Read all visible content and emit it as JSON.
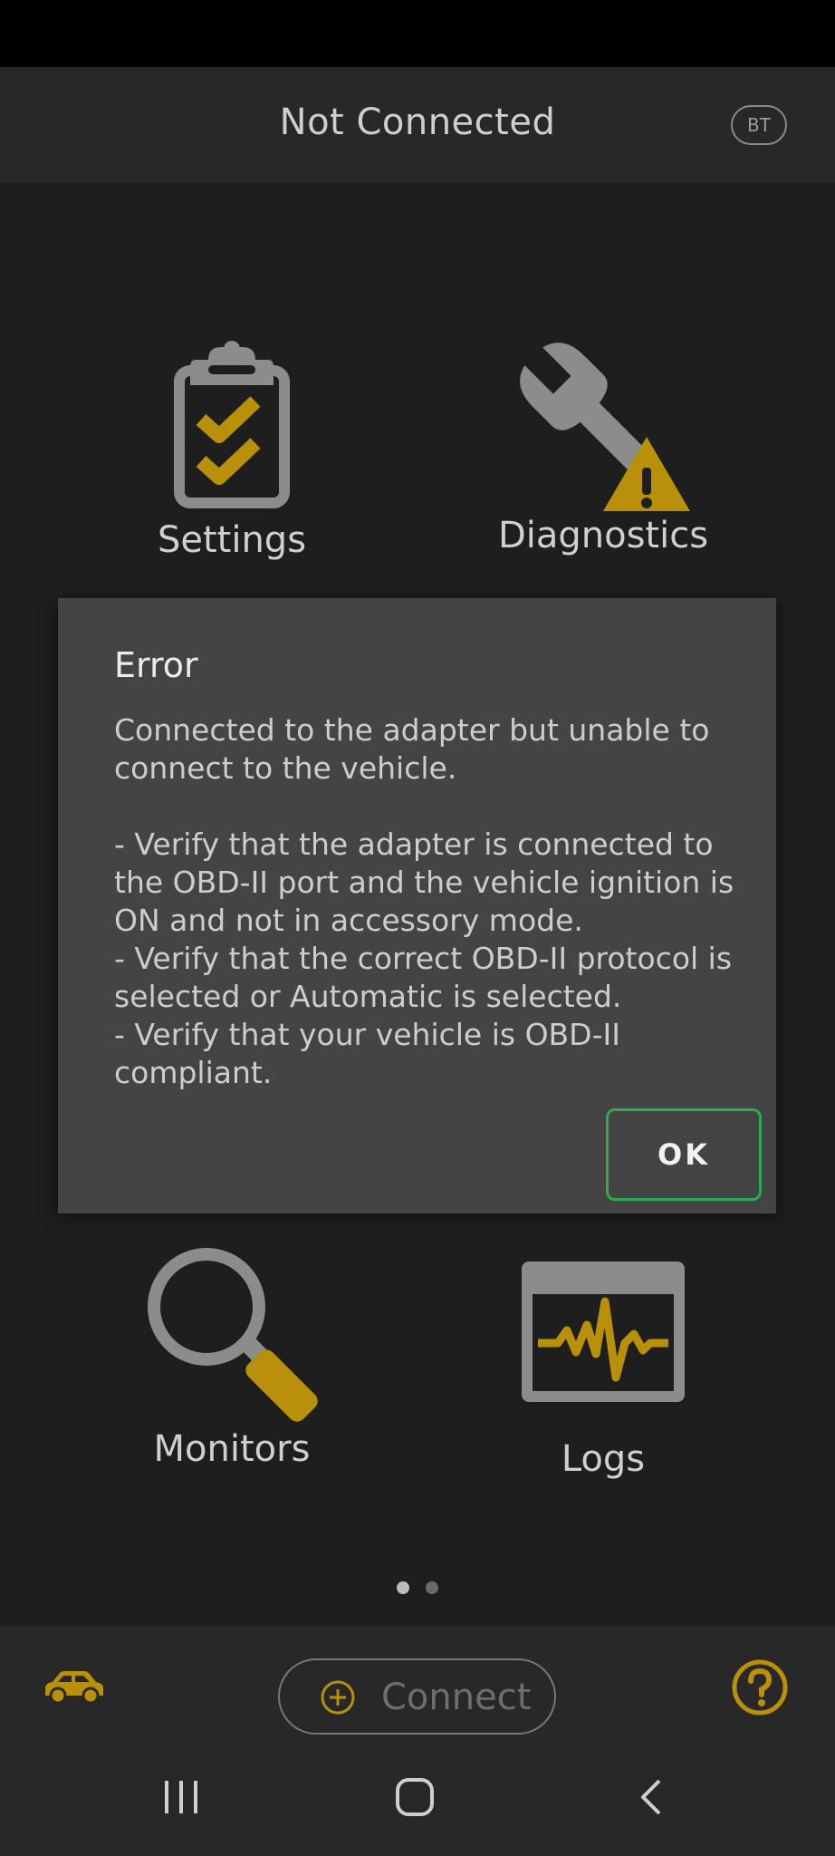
{
  "header": {
    "title": "Not Connected",
    "bt_badge": "BT"
  },
  "tiles": {
    "settings": {
      "label": "Settings",
      "icon": "clipboard-check-icon"
    },
    "diagnostics": {
      "label": "Diagnostics",
      "icon": "wrench-warning-icon"
    },
    "monitors": {
      "label": "Monitors",
      "icon": "magnifier-icon"
    },
    "logs": {
      "label": "Logs",
      "icon": "waveform-monitor-icon"
    }
  },
  "pager": {
    "pages": 2,
    "current": 1
  },
  "bottom": {
    "connect_label": "Connect"
  },
  "dialog": {
    "title": "Error",
    "message": "Connected to the adapter but unable to connect to the vehicle.\n\n- Verify that the adapter is connected to the OBD-II port and the vehicle ignition is ON and not in accessory mode.\n- Verify that the correct OBD-II protocol is selected or Automatic is selected.\n- Verify that your vehicle is OBD-II compliant.",
    "ok_label": "OK"
  },
  "colors": {
    "accent": "#b8900a",
    "icon_gray": "#8c8c8c",
    "ok_border": "#2eaa4f"
  }
}
